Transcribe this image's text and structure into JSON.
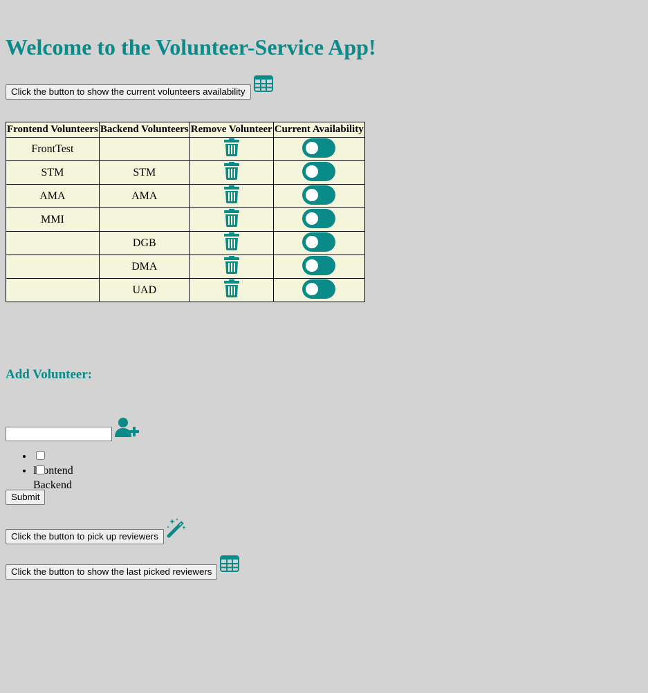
{
  "header": {
    "title": "Welcome to the Volunteer-Service App!"
  },
  "show_availability": {
    "button_label": "Click the button to show the current volunteers availability",
    "icon": "table-icon"
  },
  "table": {
    "headers": [
      "Frontend Volunteers",
      "Backend Volunteers",
      "Remove Volunteer",
      "Current Availability"
    ],
    "rows": [
      {
        "frontend": "FrontTest",
        "backend": "",
        "available": true
      },
      {
        "frontend": "STM",
        "backend": "STM",
        "available": true
      },
      {
        "frontend": "AMA",
        "backend": "AMA",
        "available": true
      },
      {
        "frontend": "MMI",
        "backend": "",
        "available": true
      },
      {
        "frontend": "",
        "backend": "DGB",
        "available": true
      },
      {
        "frontend": "",
        "backend": "DMA",
        "available": true
      },
      {
        "frontend": "",
        "backend": "UAD",
        "available": true
      }
    ],
    "remove_icon": "trash-icon"
  },
  "add_volunteer": {
    "title": "Add Volunteer:",
    "name_value": "",
    "add_icon": "user-plus-icon",
    "options": [
      {
        "label": "Frontend",
        "checked": false
      },
      {
        "label": "Backend",
        "checked": false
      }
    ],
    "submit_label": "Submit"
  },
  "pick_reviewers": {
    "button_label": "Click the button to pick up reviewers",
    "icon": "magic-wand-icon"
  },
  "last_reviewers": {
    "button_label": "Click the button to show the last picked reviewers",
    "icon": "table-icon"
  },
  "colors": {
    "accent": "#0b8a8a",
    "background": "#d3d3d3",
    "table_bg": "#f5f5dc"
  }
}
